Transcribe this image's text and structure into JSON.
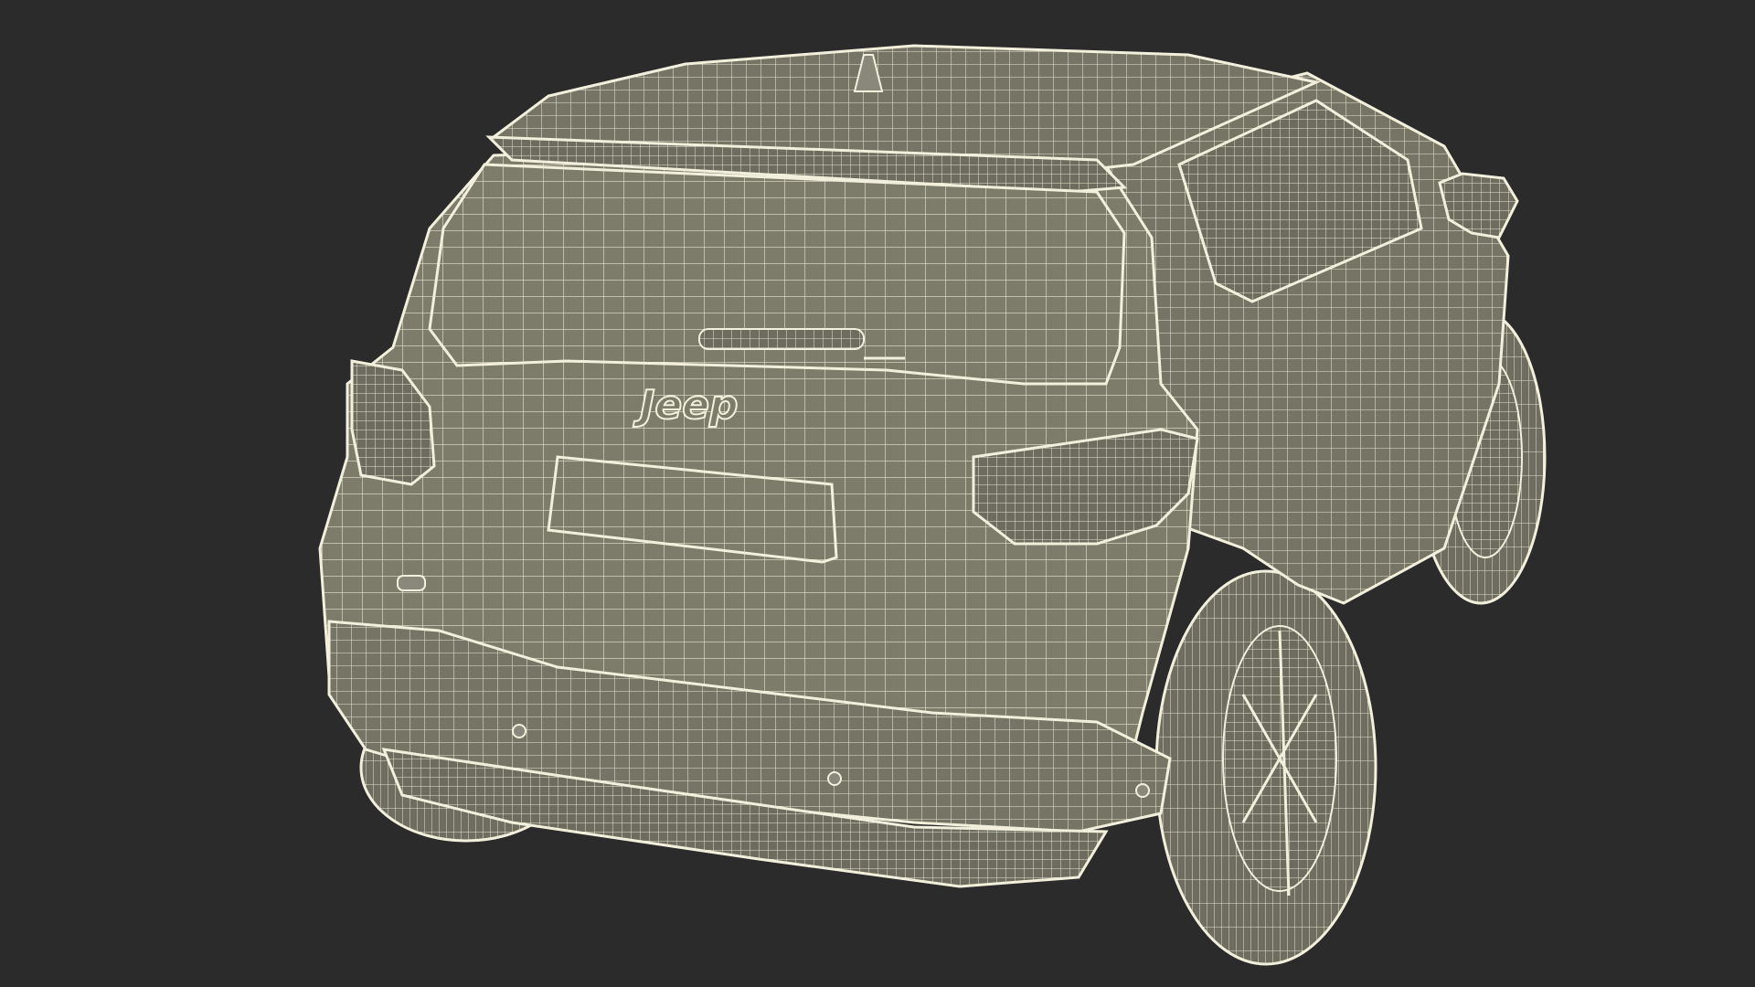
{
  "scene": {
    "background_color": "#2b2b2b",
    "surface_color": "#7d7b6a",
    "surface_dark_color": "#5f5e52",
    "wire_color": "#f2f0dc",
    "brand_badge": "Jeep"
  }
}
